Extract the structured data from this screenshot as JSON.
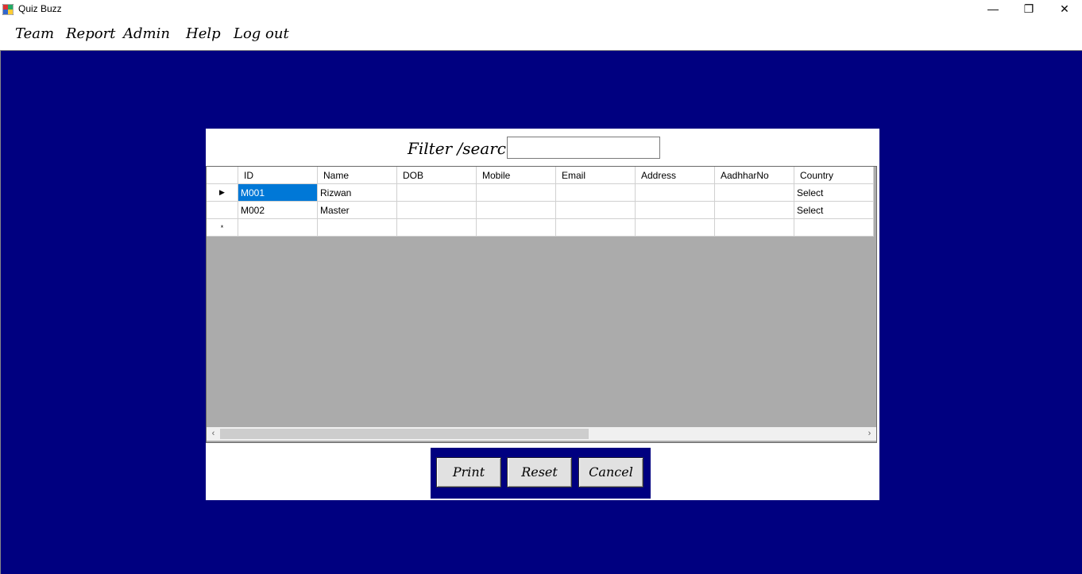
{
  "window": {
    "title": "Quiz Buzz",
    "minimize": "—",
    "restore": "❐",
    "close": "✕"
  },
  "menu": [
    "Team",
    "Report",
    "Admin",
    "Help",
    "Log out"
  ],
  "filter": {
    "label": "Filter /search",
    "value": ""
  },
  "grid": {
    "columns": [
      "ID",
      "Name",
      "DOB",
      "Mobile",
      "Email",
      "Address",
      "AadhharNo",
      "Country"
    ],
    "rows": [
      {
        "marker": "▶",
        "cells": [
          "M001",
          "Rizwan",
          "",
          "",
          "",
          "",
          "",
          "Select"
        ]
      },
      {
        "marker": "",
        "cells": [
          "M002",
          "Master",
          "",
          "",
          "",
          "",
          "",
          "Select"
        ]
      },
      {
        "marker": "*",
        "cells": [
          "",
          "",
          "",
          "",
          "",
          "",
          "",
          ""
        ]
      }
    ],
    "selected_cell": "M001",
    "scroll_left": "‹",
    "scroll_right": "›"
  },
  "buttons": {
    "print": "Print",
    "reset": "Reset",
    "cancel": "Cancel"
  },
  "colors": {
    "background": "#000080",
    "selection": "#0078d7"
  }
}
